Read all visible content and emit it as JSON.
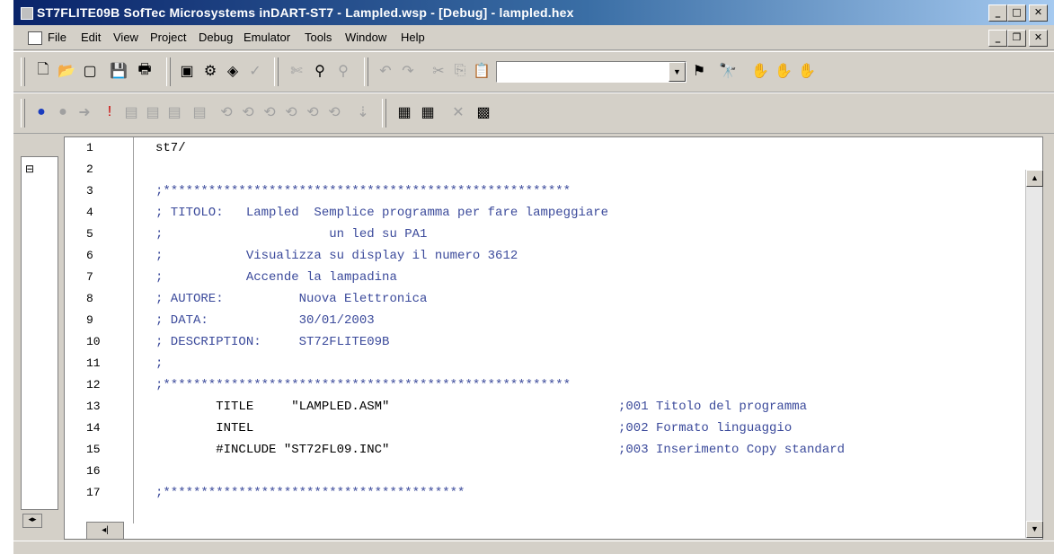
{
  "window": {
    "title": "ST7FLITE09B SofTec Microsystems  inDART-ST7 - Lampled.wsp - [Debug] - lampled.hex",
    "controls": {
      "minimize": "_",
      "maximize": "□",
      "close": "✕"
    }
  },
  "menubar": {
    "items": [
      "File",
      "Edit",
      "View",
      "Project",
      "Debug",
      "Emulator",
      "Tools",
      "Window",
      "Help"
    ],
    "doc_controls": {
      "minimize": "_",
      "restore": "❐",
      "close": "✕"
    }
  },
  "toolbar1": {
    "icons": [
      "new-file-icon",
      "open-file-icon",
      "open-workspace-icon",
      "save-icon",
      "print-icon",
      "compile-icon",
      "build-icon",
      "rebuild-icon",
      "check-icon",
      "cut-icon",
      "find-in-files-icon",
      "find-icon",
      "undo-icon",
      "redo-icon",
      "cut-icon",
      "copy-icon",
      "paste-icon",
      "find-combo-icon",
      "binoculars-icon",
      "hand-icon",
      "hand-all-icon",
      "hand-remove-icon"
    ],
    "search_value": ""
  },
  "toolbar2": {
    "icons": [
      "run-icon",
      "stop-icon",
      "reset-icon",
      "breakpoint-icon",
      "step-into-icon",
      "step-over-icon",
      "step-out-icon",
      "memory-icon",
      "registers-icon",
      "watch-icon",
      "stack-icon",
      "disasm-icon",
      "peripheral-icon",
      "trace-icon",
      "chart-icon",
      "calc-icon"
    ]
  },
  "left_panel": {
    "tree_expand": "⊟"
  },
  "editor": {
    "line_numbers": [
      "1",
      "2",
      "3",
      "4",
      "5",
      "6",
      "7",
      "8",
      "9",
      "10",
      "11",
      "12",
      "13",
      "14",
      "15",
      "16",
      "17"
    ],
    "lines": [
      "st7/",
      "",
      ";******************************************************",
      "; TITOLO:   Lampled  Semplice programma per fare lampeggiare",
      ";                      un led su PA1",
      ";           Visualizza su display il numero 3612",
      ";           Accende la lampadina",
      "; AUTORE:          Nuova Elettronica",
      "; DATA:            30/01/2003",
      "; DESCRIPTION:     ST72FLITE09B",
      ";",
      ";******************************************************",
      "        TITLE     \"LAMPLED.ASM\"",
      "        INTEL",
      "        #INCLUDE \"ST72FL09.INC\"",
      "",
      ";****************************************"
    ],
    "comments": {
      "13": ";001 Titolo del programma",
      "14": ";002 Formato linguaggio",
      "15": ";003 Inserimento Copy standard"
    }
  }
}
